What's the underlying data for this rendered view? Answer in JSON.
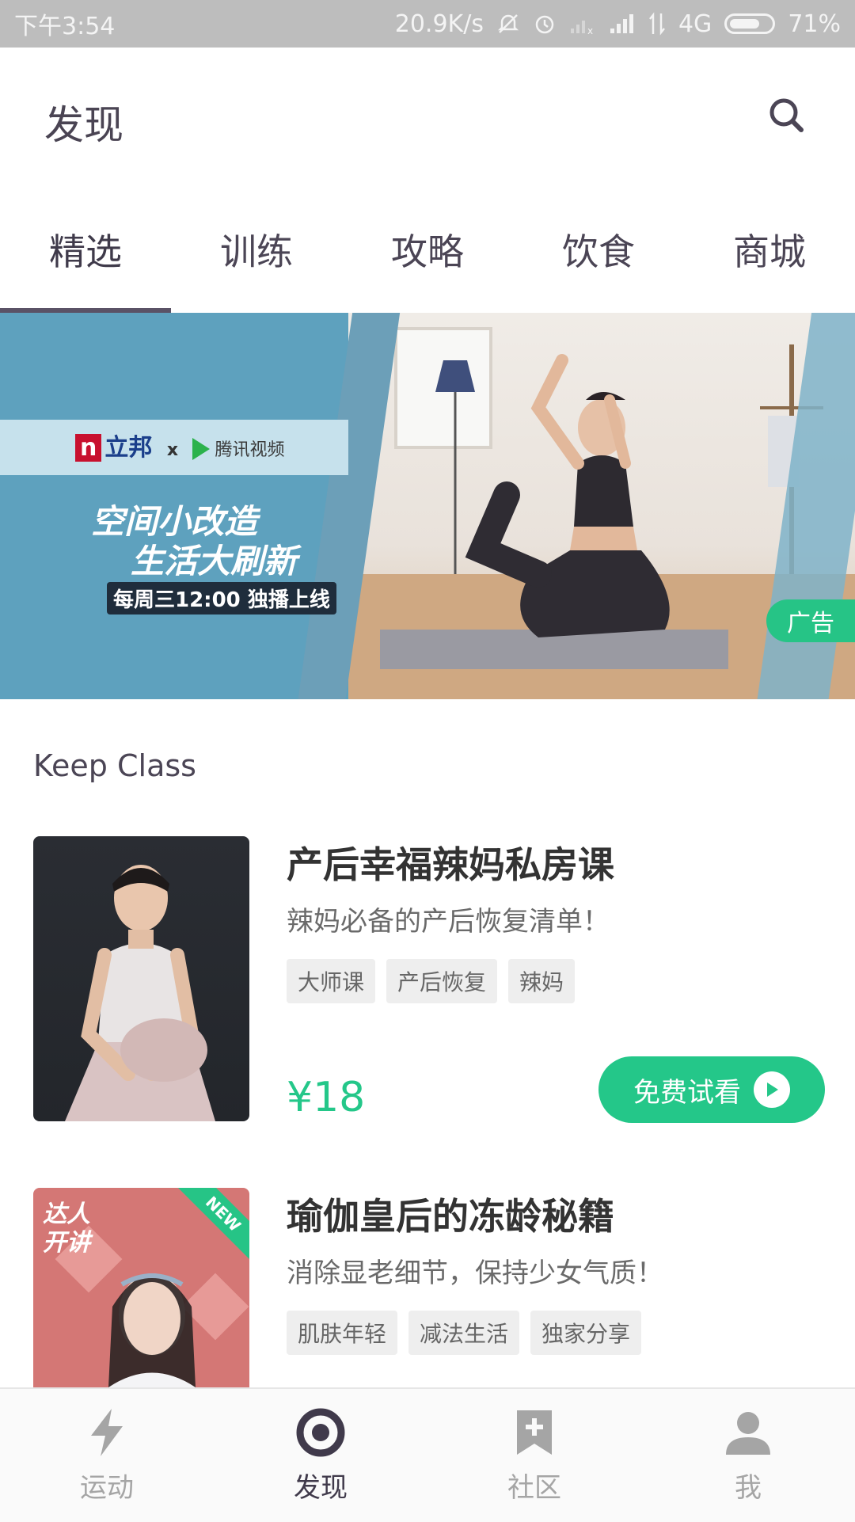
{
  "status_bar": {
    "time": "下午3:54",
    "net_speed": "20.9K/s",
    "network_type": "4G",
    "battery": "71%",
    "battery_level": 0.71
  },
  "header": {
    "title": "发现",
    "search_icon": "search-icon"
  },
  "tabs": [
    {
      "label": "精选",
      "active": true
    },
    {
      "label": "训练",
      "active": false
    },
    {
      "label": "攻略",
      "active": false
    },
    {
      "label": "饮食",
      "active": false
    },
    {
      "label": "商城",
      "active": false
    }
  ],
  "banner": {
    "brand_left": "立邦",
    "brand_sep": "x",
    "brand_right": "腾讯视频",
    "line1": "空间小改造",
    "line2": "生活大刷新",
    "line3": "每周三12:00 独播上线",
    "ad_label": "广告"
  },
  "section": {
    "title": "Keep Class"
  },
  "courses": [
    {
      "title": "产后幸福辣妈私房课",
      "subtitle": "辣妈必备的产后恢复清单！",
      "tags": [
        "大师课",
        "产后恢复",
        "辣妈"
      ],
      "price": "¥18",
      "button": "免费试看"
    },
    {
      "title": "瑜伽皇后的冻龄秘籍",
      "subtitle": "消除显老细节，保持少女气质！",
      "tags": [
        "肌肤年轻",
        "减法生活",
        "独家分享"
      ],
      "badge": "NEW",
      "thumb_label_1": "达人",
      "thumb_label_2": "开讲"
    }
  ],
  "bottom_nav": [
    {
      "label": "运动",
      "icon": "lightning-icon",
      "active": false
    },
    {
      "label": "发现",
      "icon": "discover-icon",
      "active": true
    },
    {
      "label": "社区",
      "icon": "bookmark-plus-icon",
      "active": false
    },
    {
      "label": "我",
      "icon": "person-icon",
      "active": false
    }
  ],
  "colors": {
    "accent": "#24c789",
    "tab_indicator": "#5a5266",
    "status_bar": "#bdbdbd"
  }
}
